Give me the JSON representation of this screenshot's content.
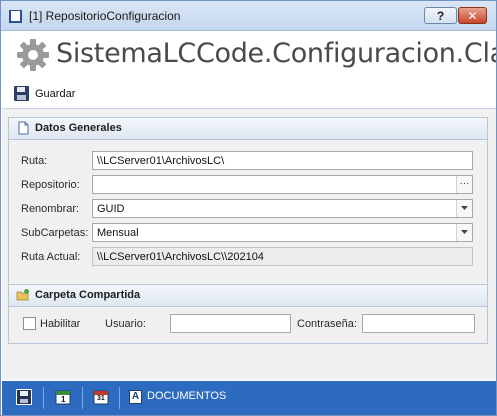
{
  "window": {
    "title": "[1] RepositorioConfiguracion",
    "help_label": "?",
    "close_label": "✕"
  },
  "header": {
    "title": "SistemaLCCode.Configuracion.Clases.R"
  },
  "toolbar": {
    "save_label": "Guardar"
  },
  "general": {
    "title": "Datos Generales",
    "ruta_label": "Ruta:",
    "ruta_value": "\\\\LCServer01\\ArchivosLC\\",
    "repositorio_label": "Repositorio:",
    "repositorio_value": "",
    "repositorio_button": "···",
    "renombrar_label": "Renombrar:",
    "renombrar_value": "GUID",
    "subcarpetas_label": "SubCarpetas:",
    "subcarpetas_value": "Mensual",
    "ruta_actual_label": "Ruta Actual:",
    "ruta_actual_value": "\\\\LCServer01\\ArchivosLC\\\\202104"
  },
  "shared": {
    "title": "Carpeta Compartida",
    "habilitar_label": "Habilitar",
    "habilitar_checked": false,
    "usuario_label": "Usuario:",
    "usuario_value": "",
    "contrasena_label": "Contraseña:",
    "contrasena_value": ""
  },
  "bottom": {
    "documentos_label": "DOCUMENTOS",
    "calendar_day": "31",
    "small_calendar_day": "1"
  },
  "colors": {
    "bottom_bar": "#2c6bbf",
    "title_bar": "#c5d7ee",
    "close_button": "#c8452b"
  },
  "icons": {
    "header": "gear-icon",
    "save": "floppy-disk-icon",
    "general": "document-icon",
    "shared": "folder-icon",
    "dropdown": "chevron-down-icon"
  }
}
